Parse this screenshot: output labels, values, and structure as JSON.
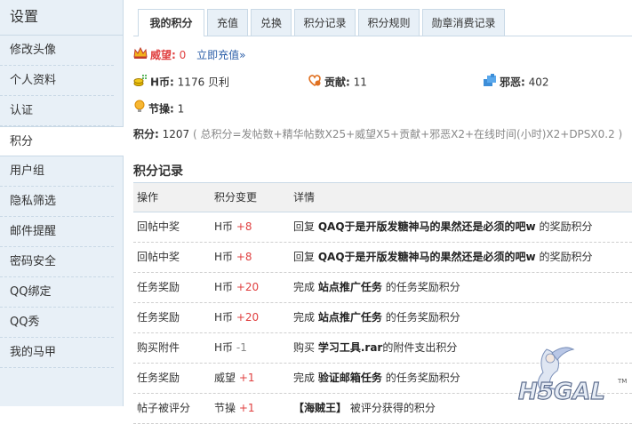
{
  "sidebar": {
    "title": "设置",
    "items": [
      {
        "label": "修改头像"
      },
      {
        "label": "个人资料"
      },
      {
        "label": "认证"
      },
      {
        "label": "积分"
      },
      {
        "label": "用户组"
      },
      {
        "label": "隐私筛选"
      },
      {
        "label": "邮件提醒"
      },
      {
        "label": "密码安全"
      },
      {
        "label": "QQ绑定"
      },
      {
        "label": "QQ秀"
      },
      {
        "label": "我的马甲"
      }
    ]
  },
  "tabs": [
    {
      "label": "我的积分"
    },
    {
      "label": "充值"
    },
    {
      "label": "兑换"
    },
    {
      "label": "积分记录"
    },
    {
      "label": "积分规则"
    },
    {
      "label": "勋章消费记录"
    }
  ],
  "stats": {
    "prestige_label": "威望:",
    "prestige_value": "0",
    "recharge_link": "立即充值»",
    "hcoin_label": "H币:",
    "hcoin_value": "1176 贝利",
    "contribution_label": "贡献:",
    "contribution_value": "11",
    "evil_label": "邪恶:",
    "evil_value": "402",
    "integrity_label": "节操:",
    "integrity_value": "1",
    "points_label": "积分:",
    "points_value": "1207",
    "points_formula": "( 总积分=发帖数+精华帖数X25+威望X5+贡献+邪恶X2+在线时间(小时)X2+DPSX0.2 )"
  },
  "records": {
    "title": "积分记录",
    "headers": {
      "action": "操作",
      "change": "积分变更",
      "detail": "详情"
    },
    "rows": [
      {
        "action": "回帖中奖",
        "currency": "H币",
        "amount": "+8",
        "pre": "回复",
        "bold": "QAQ于是开版发糖神马的果然还是必须的吧w",
        "post": "的奖励积分"
      },
      {
        "action": "回帖中奖",
        "currency": "H币",
        "amount": "+8",
        "pre": "回复",
        "bold": "QAQ于是开版发糖神马的果然还是必须的吧w",
        "post": "的奖励积分"
      },
      {
        "action": "任务奖励",
        "currency": "H币",
        "amount": "+20",
        "pre": "完成",
        "bold": "站点推广任务",
        "post": "的任务奖励积分"
      },
      {
        "action": "任务奖励",
        "currency": "H币",
        "amount": "+20",
        "pre": "完成",
        "bold": "站点推广任务",
        "post": "的任务奖励积分"
      },
      {
        "action": "购买附件",
        "currency": "H币",
        "amount": "-1",
        "pre": "购买",
        "bold": "学习工具.rar",
        "post": "的附件支出积分"
      },
      {
        "action": "任务奖励",
        "currency": "威望",
        "amount": "+1",
        "pre": "完成",
        "bold": "验证邮箱任务",
        "post": "的任务奖励积分"
      },
      {
        "action": "帖子被评分",
        "currency": "节操",
        "amount": "+1",
        "pre": "",
        "bold": "【海贼王】",
        "post": "被评分获得的积分"
      }
    ]
  },
  "logo": {
    "text": "H5GAL",
    "tm": "TM"
  }
}
